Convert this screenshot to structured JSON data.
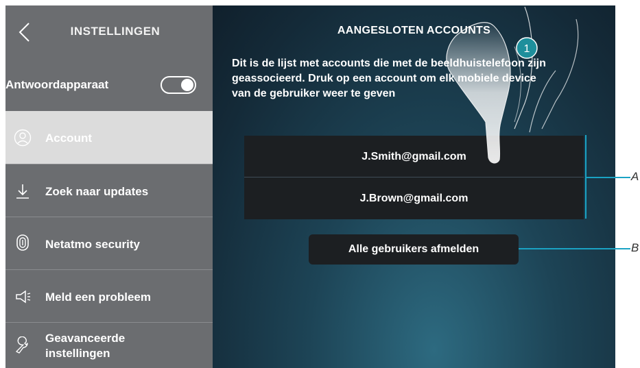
{
  "sidebar": {
    "title": "INSTELLINGEN",
    "answering_machine": {
      "label": "Antwoordapparaat",
      "enabled": true
    },
    "items": [
      {
        "label": "Account",
        "icon": "user-circle-icon",
        "selected": true
      },
      {
        "label": "Zoek naar updates",
        "icon": "download-arrow-icon"
      },
      {
        "label": "Netatmo security",
        "icon": "netatmo-icon"
      },
      {
        "label": "Meld een probleem",
        "icon": "megaphone-icon"
      },
      {
        "label": "Geavanceerde instellingen",
        "icon": "wrench-icon"
      }
    ]
  },
  "main": {
    "title": "AANGESLOTEN ACCOUNTS",
    "description": "Dit is de lijst met accounts die met de beeldhuistelefoon zijn geassocieerd. Druk op een account om elk mobiele device van de gebruiker weer te geven",
    "accounts": [
      "J.Smith@gmail.com",
      "J.Brown@gmail.com"
    ],
    "logout_label": "Alle gebruikers afmelden"
  },
  "annotations": {
    "step_badge": "1",
    "label_a": "A",
    "label_b": "B"
  },
  "colors": {
    "sidebar_bg": "#6b6d70",
    "selected_bg": "#dcdcdc",
    "list_bg": "#1c1f22",
    "callout": "#1aa3c4",
    "badge": "#1e8f9c"
  }
}
